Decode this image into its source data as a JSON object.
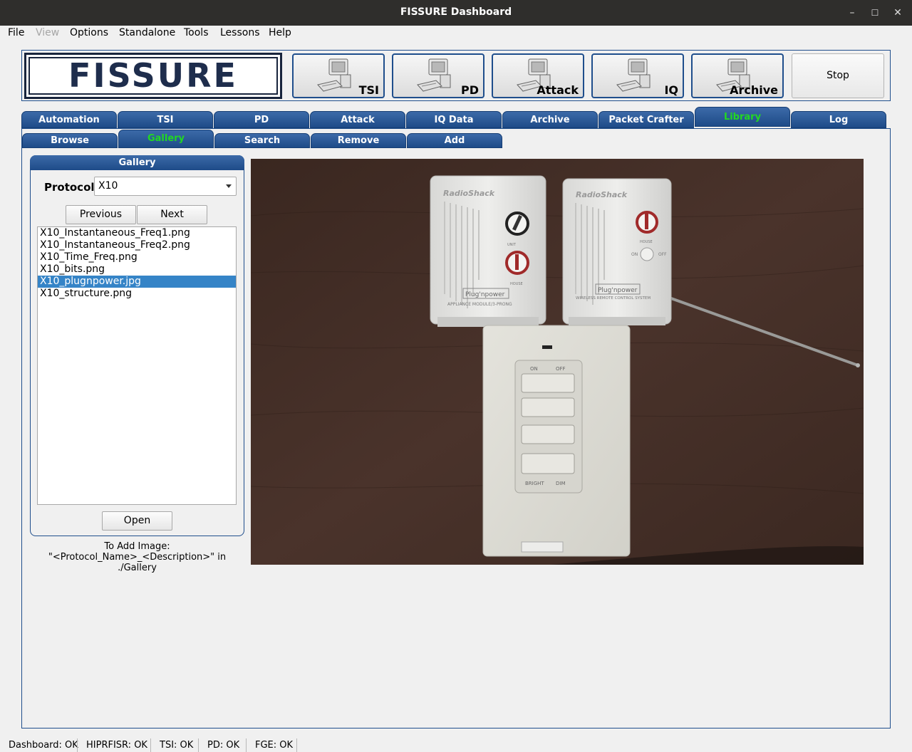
{
  "window": {
    "title": "FISSURE Dashboard"
  },
  "menu": {
    "file": "File",
    "view": "View",
    "options": "Options",
    "standalone": "Standalone",
    "tools": "Tools",
    "lessons": "Lessons",
    "help": "Help"
  },
  "logo": {
    "text": "FISSURE"
  },
  "toolbar": {
    "tsi": "TSI",
    "pd": "PD",
    "attack": "Attack",
    "iq": "IQ",
    "archive": "Archive",
    "stop": "Stop"
  },
  "tabs": [
    "Automation",
    "TSI",
    "PD",
    "Attack",
    "IQ Data",
    "Archive",
    "Packet Crafter",
    "Library",
    "Log"
  ],
  "active_tab": "Library",
  "subtabs": [
    "Browse",
    "Gallery",
    "Search",
    "Remove",
    "Add"
  ],
  "active_subtab": "Gallery",
  "gallery": {
    "header": "Gallery",
    "protocol_label": "Protocol:",
    "protocol_value": "X10",
    "previous_label": "Previous",
    "next_label": "Next",
    "files": [
      "X10_Instantaneous_Freq1.png",
      "X10_Instantaneous_Freq2.png",
      "X10_Time_Freq.png",
      "X10_bits.png",
      "X10_plugnpower.jpg",
      "X10_structure.png"
    ],
    "selected_file": "X10_plugnpower.jpg",
    "open_label": "Open",
    "note_line1": "To Add Image:",
    "note_line2": "\"<Protocol_Name>_<Description>\" in ./Gallery"
  },
  "photo": {
    "brand_left": "RadioShack",
    "brand_right": "RadioShack",
    "module_left_logo": "Plug'npower",
    "module_left_caption": "APPLIANCE MODULE/3-PRONG",
    "module_right_logo": "Plug'npower",
    "module_right_caption": "WIRELESS REMOTE CONTROL SYSTEM",
    "unit_label": "UNIT",
    "house_label": "HOUSE",
    "switch_on": "ON",
    "switch_off": "OFF",
    "remote_on": "ON",
    "remote_off": "OFF",
    "remote_bright": "BRIGHT",
    "remote_dim": "DIM"
  },
  "status": {
    "dashboard": "Dashboard: OK",
    "hiprfisr": "HIPRFISR: OK",
    "tsi": "TSI: OK",
    "pd": "PD: OK",
    "fge": "FGE: OK"
  }
}
